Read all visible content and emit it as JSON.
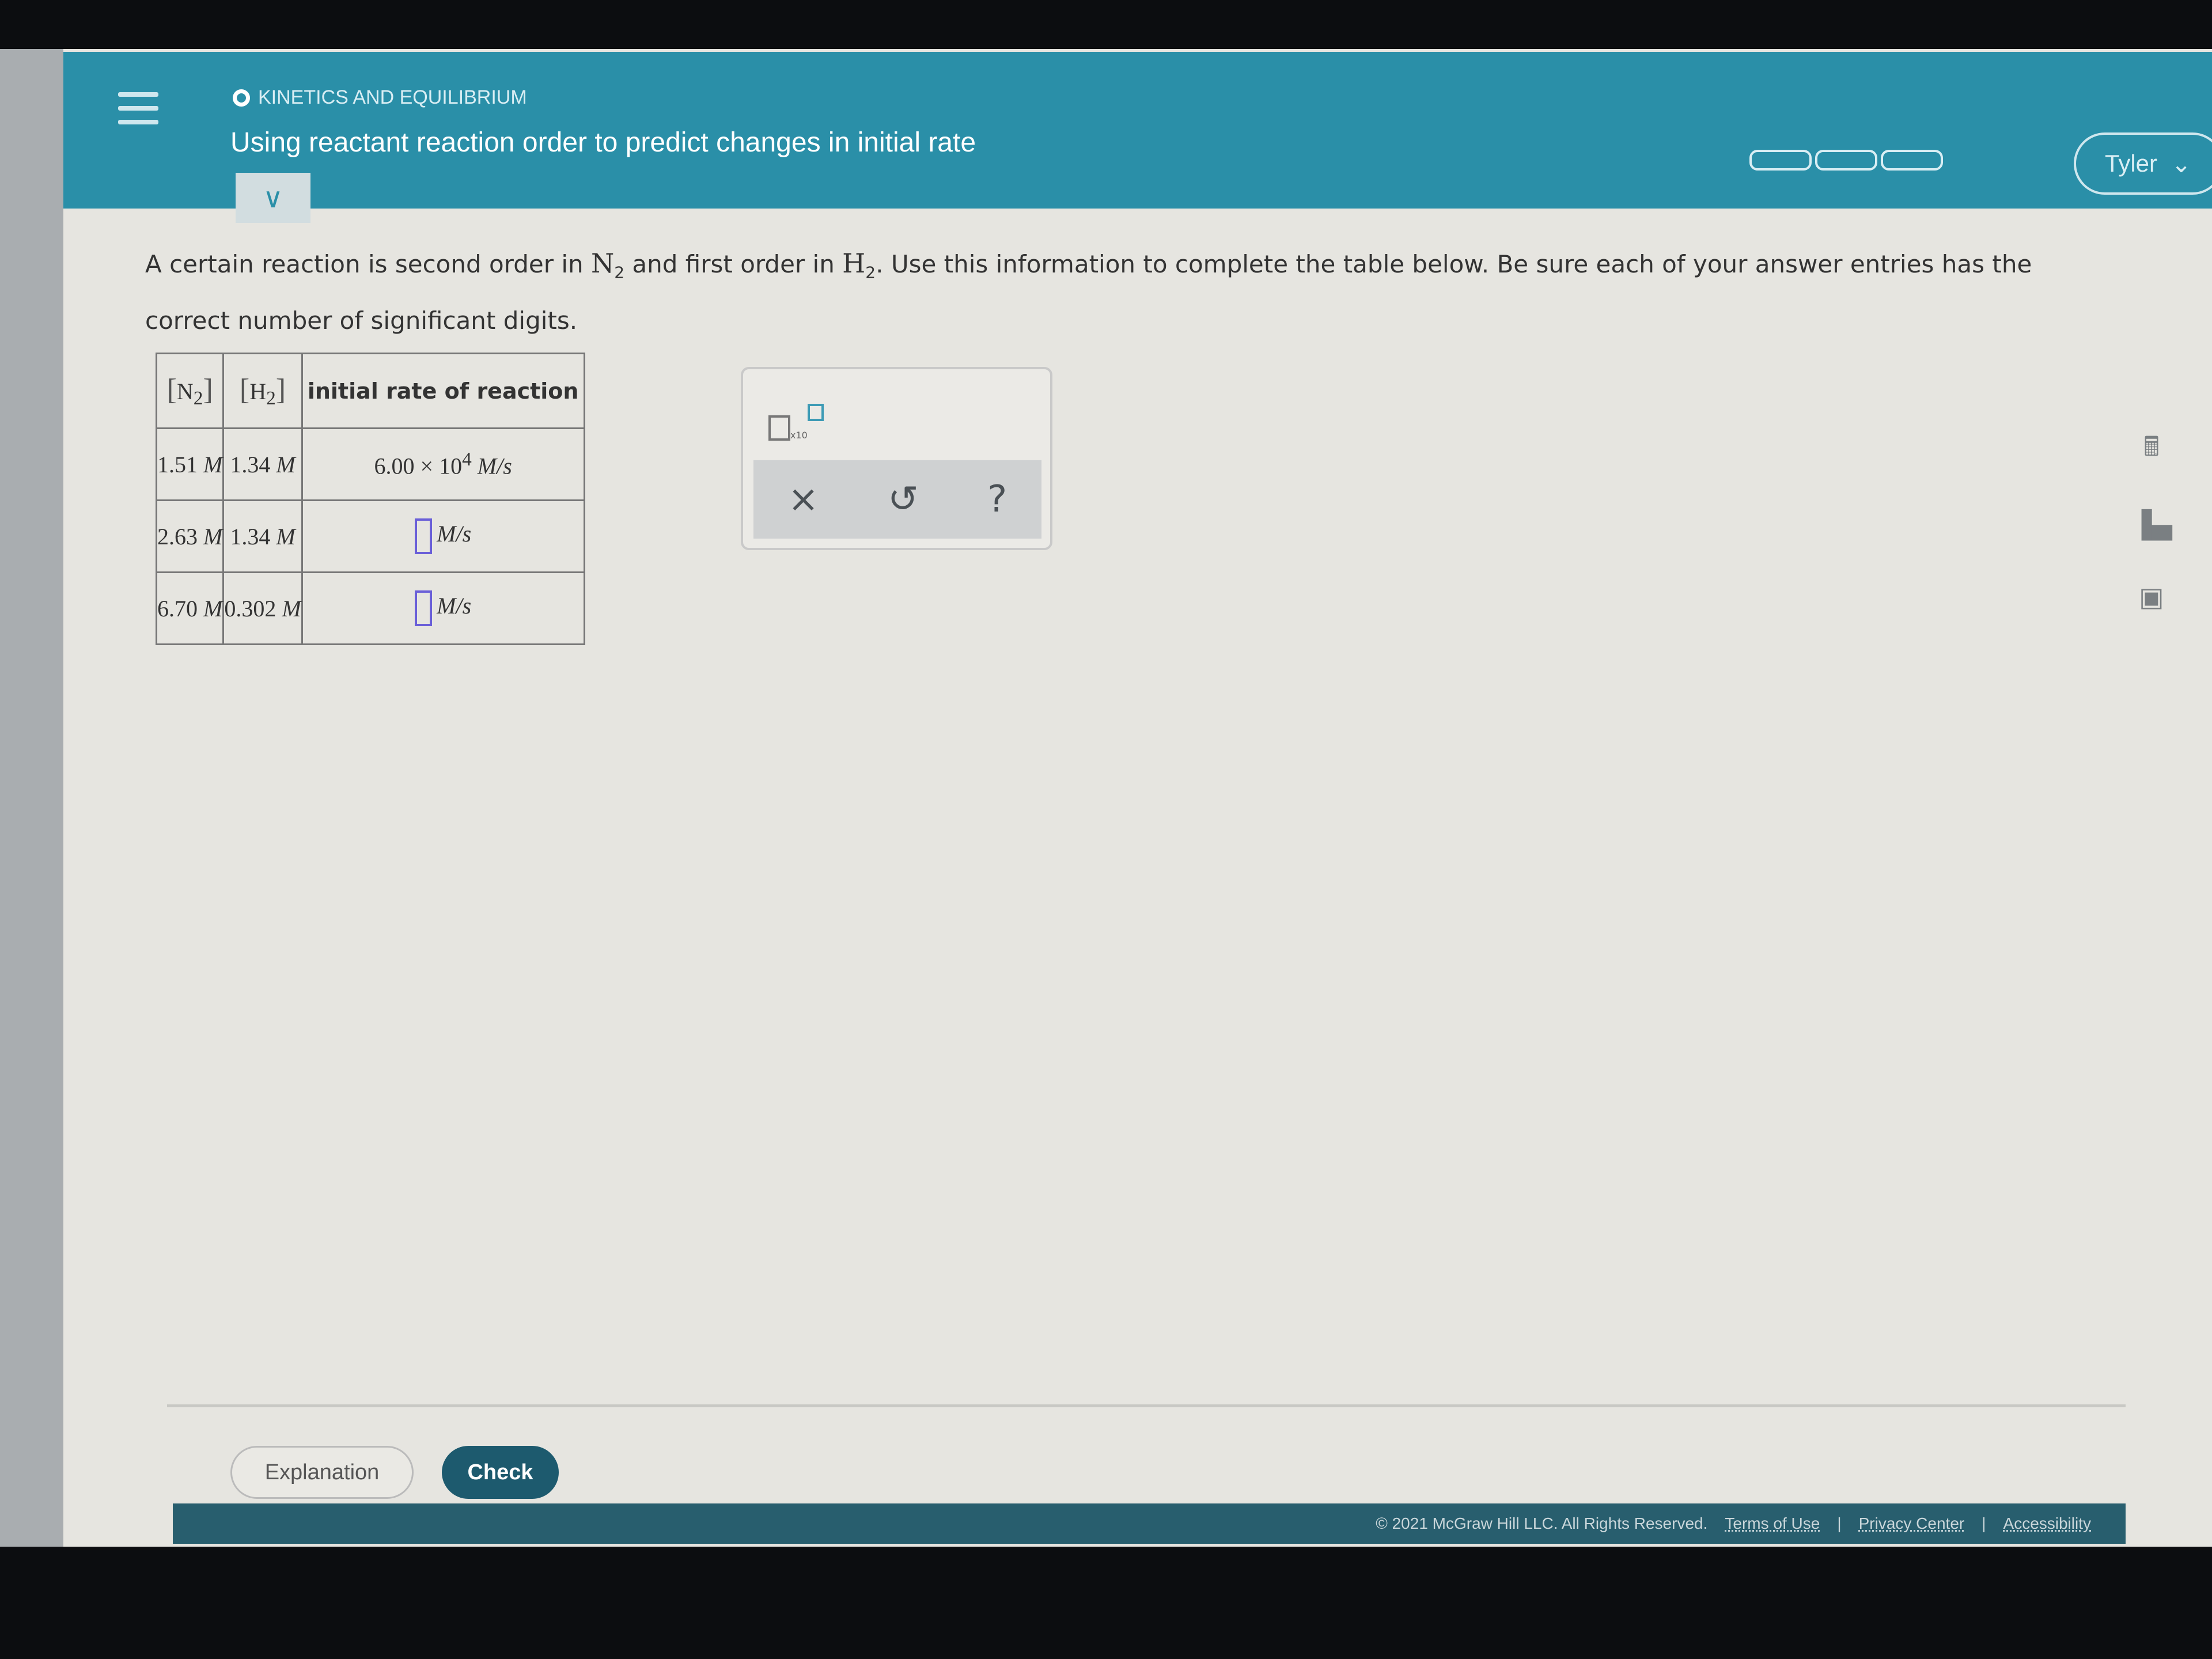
{
  "header": {
    "topic": "KINETICS AND EQUILIBRIUM",
    "title": "Using reactant reaction order to predict changes in initial rate",
    "user": "Tyler",
    "progress_segments": 3
  },
  "question": {
    "p1": "A certain reaction is second order in ",
    "s1": "N",
    "p2": " and first order in ",
    "s2": "H",
    "p3": ". Use this information to complete the table below. Be sure each of your answer entries has the correct number of significant digits.",
    "sub": "2"
  },
  "table": {
    "headers": [
      "N",
      "H",
      "initial rate of reaction"
    ],
    "rows": [
      {
        "n2": "1.51",
        "h2": "1.34",
        "rate_mantissa": "6.00",
        "rate_exp": "4"
      },
      {
        "n2": "2.63",
        "h2": "1.34",
        "rate": ""
      },
      {
        "n2": "6.70",
        "h2": "0.302",
        "rate": ""
      }
    ],
    "unit_M": "M",
    "unit_rate": "M/s",
    "times_ten": "× 10"
  },
  "widget": {
    "x10": "x10",
    "clear": "×",
    "undo": "↺",
    "help": "?"
  },
  "buttons": {
    "explanation": "Explanation",
    "check": "Check"
  },
  "footer": {
    "copyright": "© 2021 McGraw Hill LLC. All Rights Reserved.",
    "links": [
      "Terms of Use",
      "Privacy Center",
      "Accessibility"
    ]
  },
  "colors": {
    "header": "#2a8fa8",
    "check_button": "#1d5a6e",
    "answer_box": "#6a5fd8"
  }
}
